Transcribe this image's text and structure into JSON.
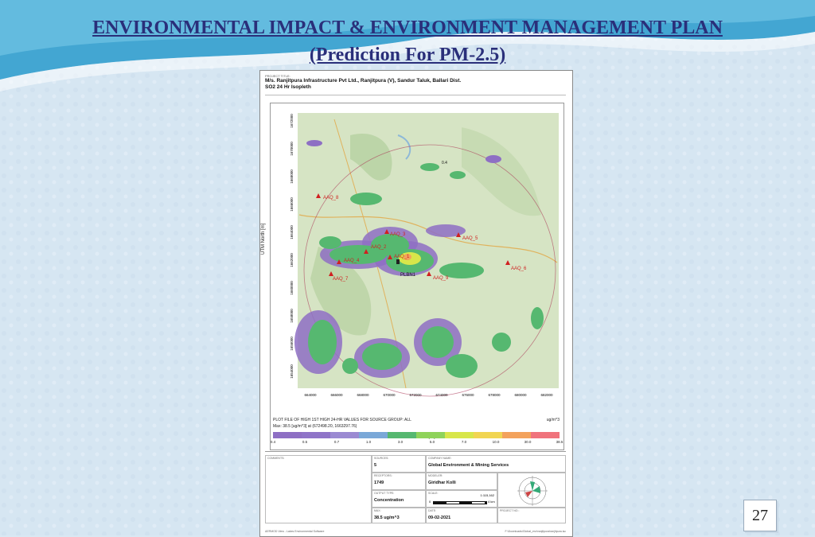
{
  "slide": {
    "title_line1": "ENVIRONMENTAL IMPACT  & ENVIRONMENT MANAGEMENT PLAN",
    "title_line2": "(Prediction For PM-2.5)",
    "page_number": "27"
  },
  "map": {
    "project_title_label": "PROJECT TITLE:",
    "project_line1": "M/s. Ranjitpura Infrastructure Pvt Ltd., Ranjitpura (V), Sandur Taluk, Ballari Dist.",
    "project_line2": "SO2 24 Hr Isopleth",
    "y_axis_label": "UTM North [m]",
    "x_axis_label": "UTM East [m]",
    "y_ticks": [
      "1672000",
      "1670000",
      "1668000",
      "1666000",
      "1664000",
      "1662000",
      "1660000",
      "1658000",
      "1656000",
      "1654000"
    ],
    "x_ticks": [
      "664000",
      "666000",
      "668000",
      "670000",
      "672000",
      "674000",
      "676000",
      "678000",
      "680000",
      "682000"
    ],
    "stations": [
      "AAQ_1",
      "AAQ_2",
      "AAQ_3",
      "AAQ_4",
      "AAQ_5",
      "AAQ_6",
      "AAQ_7",
      "AAQ_8",
      "AAQ_9",
      "PLBN1"
    ],
    "contour_label": "0.4",
    "legend_title": "PLOT FILE OF HIGH 1ST HIGH 24-HR VALUES FOR SOURCE GROUP: ALL",
    "legend_max": "Max:  38.5  [ug/m^3]  at  (672498.20, 1663297.76)",
    "legend_unit": "ug/m^3",
    "legend_ticks": [
      "0.4",
      "0.5",
      "0.7",
      "1.0",
      "3.0",
      "5.0",
      "7.0",
      "10.0",
      "30.0",
      "38.5"
    ],
    "legend_colors": [
      "#8e6fc4",
      "#8f74c8",
      "#9b8ad2",
      "#7aa8d8",
      "#56b870",
      "#8fd35a",
      "#d8e64a",
      "#f1d552",
      "#f3a25c",
      "#f0737c"
    ],
    "comments_label": "COMMENTS:",
    "sources_label": "SOURCES:",
    "sources_value": "5",
    "company_label": "COMPANY NAME:",
    "company_value": "Global Environment & Mining Services",
    "receptors_label": "RECEPTORS:",
    "receptors_value": "1749",
    "modeler_label": "MODELER:",
    "modeler_value": "Giridhar Kolli",
    "output_label": "OUTPUT TYPE:",
    "output_value": "Concentration",
    "scale_label": "SCALE:",
    "scale_ratio": "1:115,162",
    "scale_start": "0",
    "scale_end": "4 km",
    "max_label": "MAX:",
    "max_value": "38.5 ug/m^3",
    "date_label": "DATE:",
    "date_value": "09-02-2021",
    "project_no_label": "PROJECT NO.:",
    "footer_left": "AERMOD View - Lakes Environmental Software",
    "footer_right": "F:\\Downloads\\Global_env\\ranjitpura\\ranjitpura.isc"
  },
  "colors": {
    "title": "#2a2f7a",
    "ocean_top": "#3fa3cf"
  }
}
